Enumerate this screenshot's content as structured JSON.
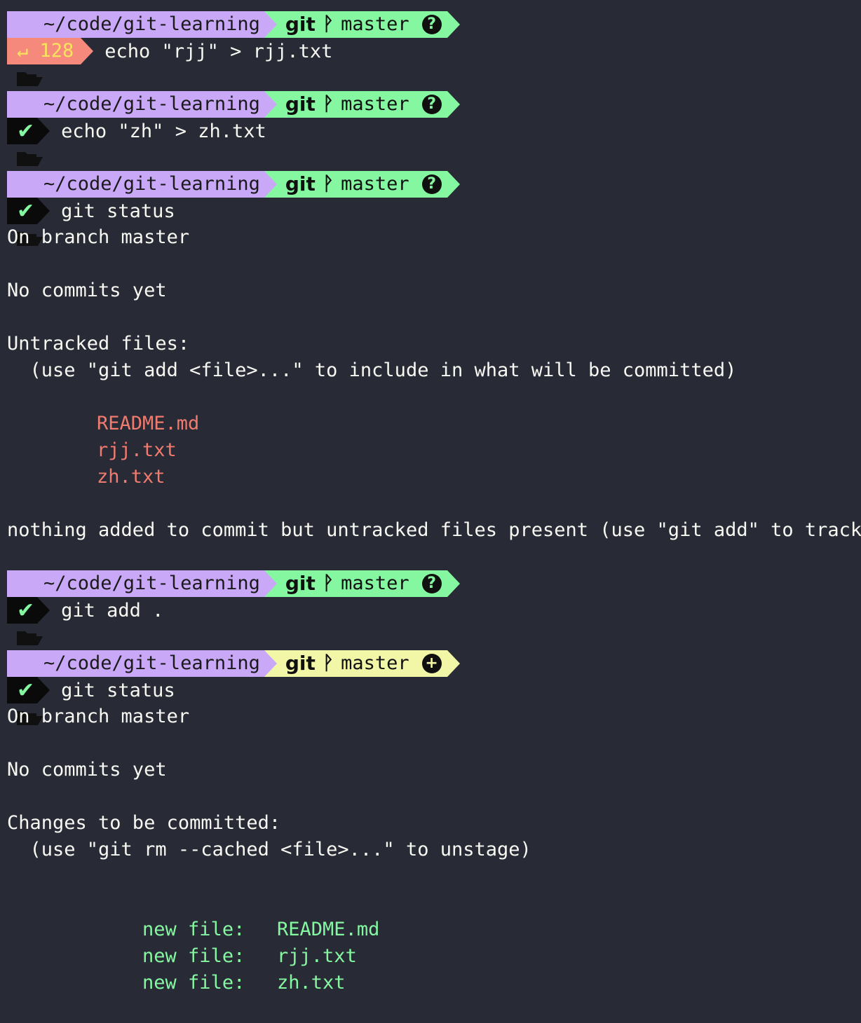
{
  "colors": {
    "background": "#282a36",
    "path_segment": "#c9a8f7",
    "git_clean_segment": "#84f7a0",
    "git_staged_segment": "#f2f7a8",
    "error_segment": "#f58a7c",
    "untracked_file": "#f07b6e",
    "staged_file": "#84f7a0"
  },
  "prompt": {
    "path": "~/code/git-learning",
    "git_label": "git",
    "branch": "master"
  },
  "blocks": [
    {
      "status": "error",
      "exit_code": "↵ 128",
      "status_icon": "question-circle-icon",
      "status_glyph": "?",
      "command": "echo \"rjj\" > rjj.txt"
    },
    {
      "status": "ok",
      "status_icon": "question-circle-icon",
      "status_glyph": "?",
      "command": "echo \"zh\" > zh.txt"
    },
    {
      "status": "ok",
      "status_icon": "question-circle-icon",
      "status_glyph": "?",
      "command": "git status"
    },
    {
      "status": "ok",
      "status_icon": "question-circle-icon",
      "status_glyph": "?",
      "command": "git add ."
    },
    {
      "status": "ok",
      "status_icon": "plus-circle-icon",
      "status_glyph": "+",
      "command": "git status"
    }
  ],
  "output1": {
    "on_branch": "On branch master",
    "no_commits": "No commits yet",
    "untracked_header": "Untracked files:",
    "untracked_hint": "  (use \"git add <file>...\" to include in what will be committed)",
    "files": [
      "README.md",
      "rjj.txt",
      "zh.txt"
    ],
    "summary": "nothing added to commit but untracked files present (use \"git add\" to track)"
  },
  "output2": {
    "on_branch": "On branch master",
    "no_commits": "No commits yet",
    "staged_header": "Changes to be committed:",
    "staged_hint": "  (use \"git rm --cached <file>...\" to unstage)",
    "entries": [
      {
        "label": "new file:",
        "file": "README.md"
      },
      {
        "label": "new file:",
        "file": "rjj.txt"
      },
      {
        "label": "new file:",
        "file": "zh.txt"
      }
    ]
  }
}
